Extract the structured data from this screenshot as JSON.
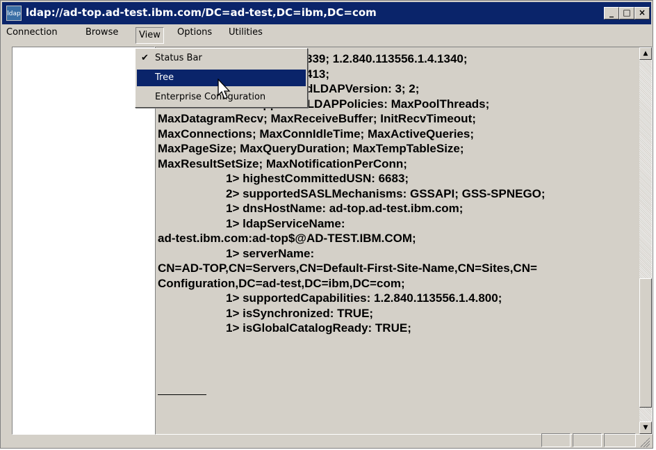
{
  "window": {
    "title": "ldap://ad-top.ad-test.ibm.com/DC=ad-test,DC=ibm,DC=com",
    "app_icon_text": "ldap",
    "controls": [
      "minimize",
      "maximize",
      "close"
    ]
  },
  "menubar": {
    "items": [
      {
        "label": "Connection"
      },
      {
        "label": "Browse"
      },
      {
        "label": "View"
      },
      {
        "label": "Options"
      },
      {
        "label": "Utilities"
      }
    ],
    "open_menu": "View"
  },
  "view_menu": {
    "items": [
      {
        "label": "Status Bar",
        "checked": true
      },
      {
        "label": "Tree",
        "highlighted": true
      },
      {
        "label": "Enterprise Configuration"
      }
    ]
  },
  "output": {
    "lines": [
      {
        "text": "339; 1.2.840.113556.1.4.1340;",
        "indent": false
      },
      {
        "text": "413;",
        "indent": false
      },
      {
        "text": "dLDAPVersion: 3; 2;",
        "indent": false
      },
      {
        "text": "12> supportedLDAPPolicies: MaxPoolThreads;",
        "indent": true
      },
      {
        "text": "MaxDatagramRecv; MaxReceiveBuffer; InitRecvTimeout;",
        "indent": false
      },
      {
        "text": "MaxConnections; MaxConnIdleTime; MaxActiveQueries;",
        "indent": false
      },
      {
        "text": "MaxPageSize; MaxQueryDuration; MaxTempTableSize;",
        "indent": false
      },
      {
        "text": "MaxResultSetSize; MaxNotificationPerConn;",
        "indent": false
      },
      {
        "text": "1> highestCommittedUSN: 6683;",
        "indent": true
      },
      {
        "text": "2> supportedSASLMechanisms: GSSAPI; GSS-SPNEGO;",
        "indent": true
      },
      {
        "text": "1> dnsHostName: ad-top.ad-test.ibm.com;",
        "indent": true
      },
      {
        "text": "1> ldapServiceName:",
        "indent": true
      },
      {
        "text": "ad-test.ibm.com:ad-top$@AD-TEST.IBM.COM;",
        "indent": false
      },
      {
        "text": "1> serverName:",
        "indent": true
      },
      {
        "text": "CN=AD-TOP,CN=Servers,CN=Default-First-Site-Name,CN=Sites,CN=",
        "indent": false
      },
      {
        "text": "Configuration,DC=ad-test,DC=ibm,DC=com;",
        "indent": false
      },
      {
        "text": "1> supportedCapabilities: 1.2.840.113556.1.4.800;",
        "indent": true
      },
      {
        "text": "1> isSynchronized: TRUE;",
        "indent": true
      },
      {
        "text": "1> isGlobalCatalogReady: TRUE;",
        "indent": true
      }
    ]
  },
  "colors": {
    "titlebar": "#0a246a",
    "face": "#d4d0c8",
    "highlight": "#0a246a"
  }
}
